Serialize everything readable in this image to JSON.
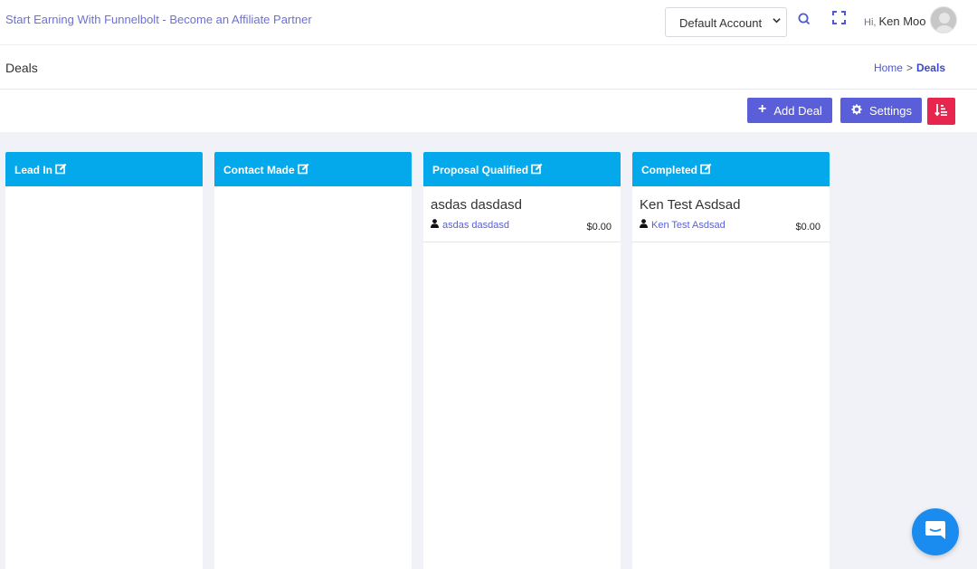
{
  "topbar": {
    "promo_link": "Start Earning With Funnelbolt - Become an Affiliate Partner",
    "account_select": {
      "selected": "Default Account"
    },
    "greeting_prefix": "Hi,",
    "user_name": "Ken Moo",
    "icons": [
      "search-icon",
      "fullscreen-icon",
      "avatar"
    ]
  },
  "page": {
    "title": "Deals",
    "breadcrumb": {
      "home": "Home",
      "separator": ">",
      "current": "Deals"
    }
  },
  "toolbar": {
    "add_label": "Add Deal",
    "settings_label": "Settings",
    "sort_icon": "sort-amount-icon"
  },
  "columns": [
    {
      "title": "Lead In",
      "cards": []
    },
    {
      "title": "Contact Made",
      "cards": []
    },
    {
      "title": "Proposal Qualified",
      "cards": [
        {
          "title": "asdas dasdasd",
          "contact": "asdas dasdasd",
          "amount": "$0.00"
        }
      ]
    },
    {
      "title": "Completed",
      "cards": [
        {
          "title": "Ken Test Asdsad",
          "contact": "Ken Test Asdsad",
          "amount": "$0.00"
        }
      ]
    }
  ],
  "colors": {
    "accent": "#5a5fd9",
    "column_header": "#03a9ea",
    "danger": "#e8254d",
    "chat": "#1a8cf0"
  }
}
